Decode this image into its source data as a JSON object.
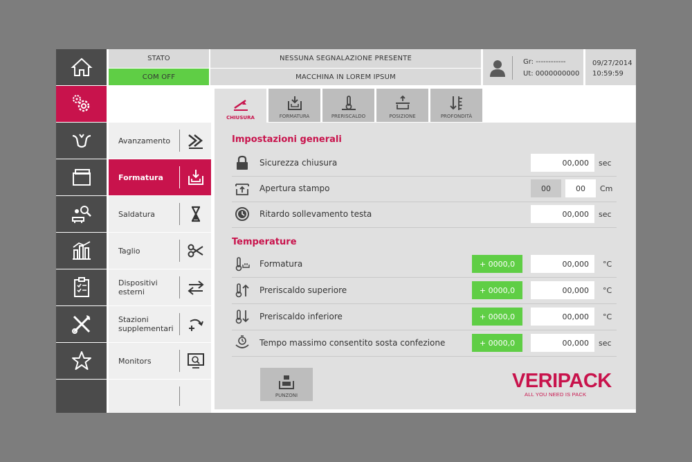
{
  "header": {
    "stato_label": "STATO",
    "stato_value": "COM OFF",
    "message": "NESSUNA SEGNALAZIONE PRESENTE",
    "machine": "MACCHINA IN LOREM IPSUM",
    "group": "Gr: ------------",
    "user": "Ut: 0000000000",
    "date": "09/27/2014",
    "time": "10:59:59"
  },
  "nav": [
    {
      "icon": "home-icon"
    },
    {
      "icon": "gears-icon"
    },
    {
      "icon": "forming-icon"
    },
    {
      "icon": "folder-icon"
    },
    {
      "icon": "diagnostics-icon"
    },
    {
      "icon": "statistics-icon"
    },
    {
      "icon": "checklist-icon"
    },
    {
      "icon": "tools-icon"
    },
    {
      "icon": "star-icon"
    }
  ],
  "submenu": [
    {
      "label": "Avanzamento",
      "icon": "advance-icon"
    },
    {
      "label": "Formatura",
      "icon": "forming-tray-icon"
    },
    {
      "label": "Saldatura",
      "icon": "hourglass-icon"
    },
    {
      "label": "Taglio",
      "icon": "scissors-icon"
    },
    {
      "label": "Dispositivi esterni",
      "icon": "exchange-arrows-icon"
    },
    {
      "label": "Stazioni supplementari",
      "icon": "add-station-icon"
    },
    {
      "label": "Monitors",
      "icon": "monitor-icon"
    }
  ],
  "tabs": [
    {
      "label": "CHIUSURA"
    },
    {
      "label": "FORMATURA"
    },
    {
      "label": "PRERISCALDO"
    },
    {
      "label": "POSIZIONE"
    },
    {
      "label": "PROFONDITÀ"
    }
  ],
  "general": {
    "title": "Impostazioni generali",
    "rows": [
      {
        "label": "Sicurezza chiusura",
        "value": "00,000",
        "unit": "sec",
        "icon": "lock-icon"
      },
      {
        "label": "Apertura stampo",
        "value_a": "00",
        "value_b": "00",
        "unit": "Cm",
        "icon": "mold-open-icon"
      },
      {
        "label": "Ritardo sollevamento testa",
        "value": "00,000",
        "unit": "sec",
        "icon": "clock-icon"
      }
    ]
  },
  "temperature": {
    "title": "Temperature",
    "rows": [
      {
        "label": "Formatura",
        "actual": "+ 0000,0",
        "value": "00,000",
        "unit": "°C",
        "icon": "thermometer-forming-icon"
      },
      {
        "label": "Preriscaldo superiore",
        "actual": "+ 0000,0",
        "value": "00,000",
        "unit": "°C",
        "icon": "thermometer-up-icon"
      },
      {
        "label": "Preriscaldo inferiore",
        "actual": "+ 0000,0",
        "value": "00,000",
        "unit": "°C",
        "icon": "thermometer-down-icon"
      },
      {
        "label": "Tempo massimo consentito sosta confezione",
        "actual": "+ 0000,0",
        "value": "00,000",
        "unit": "sec",
        "icon": "timer-pack-icon"
      }
    ]
  },
  "punzoni_label": "PUNZONI",
  "logo": {
    "brand": "VERIPACK",
    "tagline": "ALL YOU NEED IS PACK"
  },
  "colors": {
    "accent": "#c8134c",
    "ok": "#5fce45",
    "nav": "#4b4b4b"
  }
}
